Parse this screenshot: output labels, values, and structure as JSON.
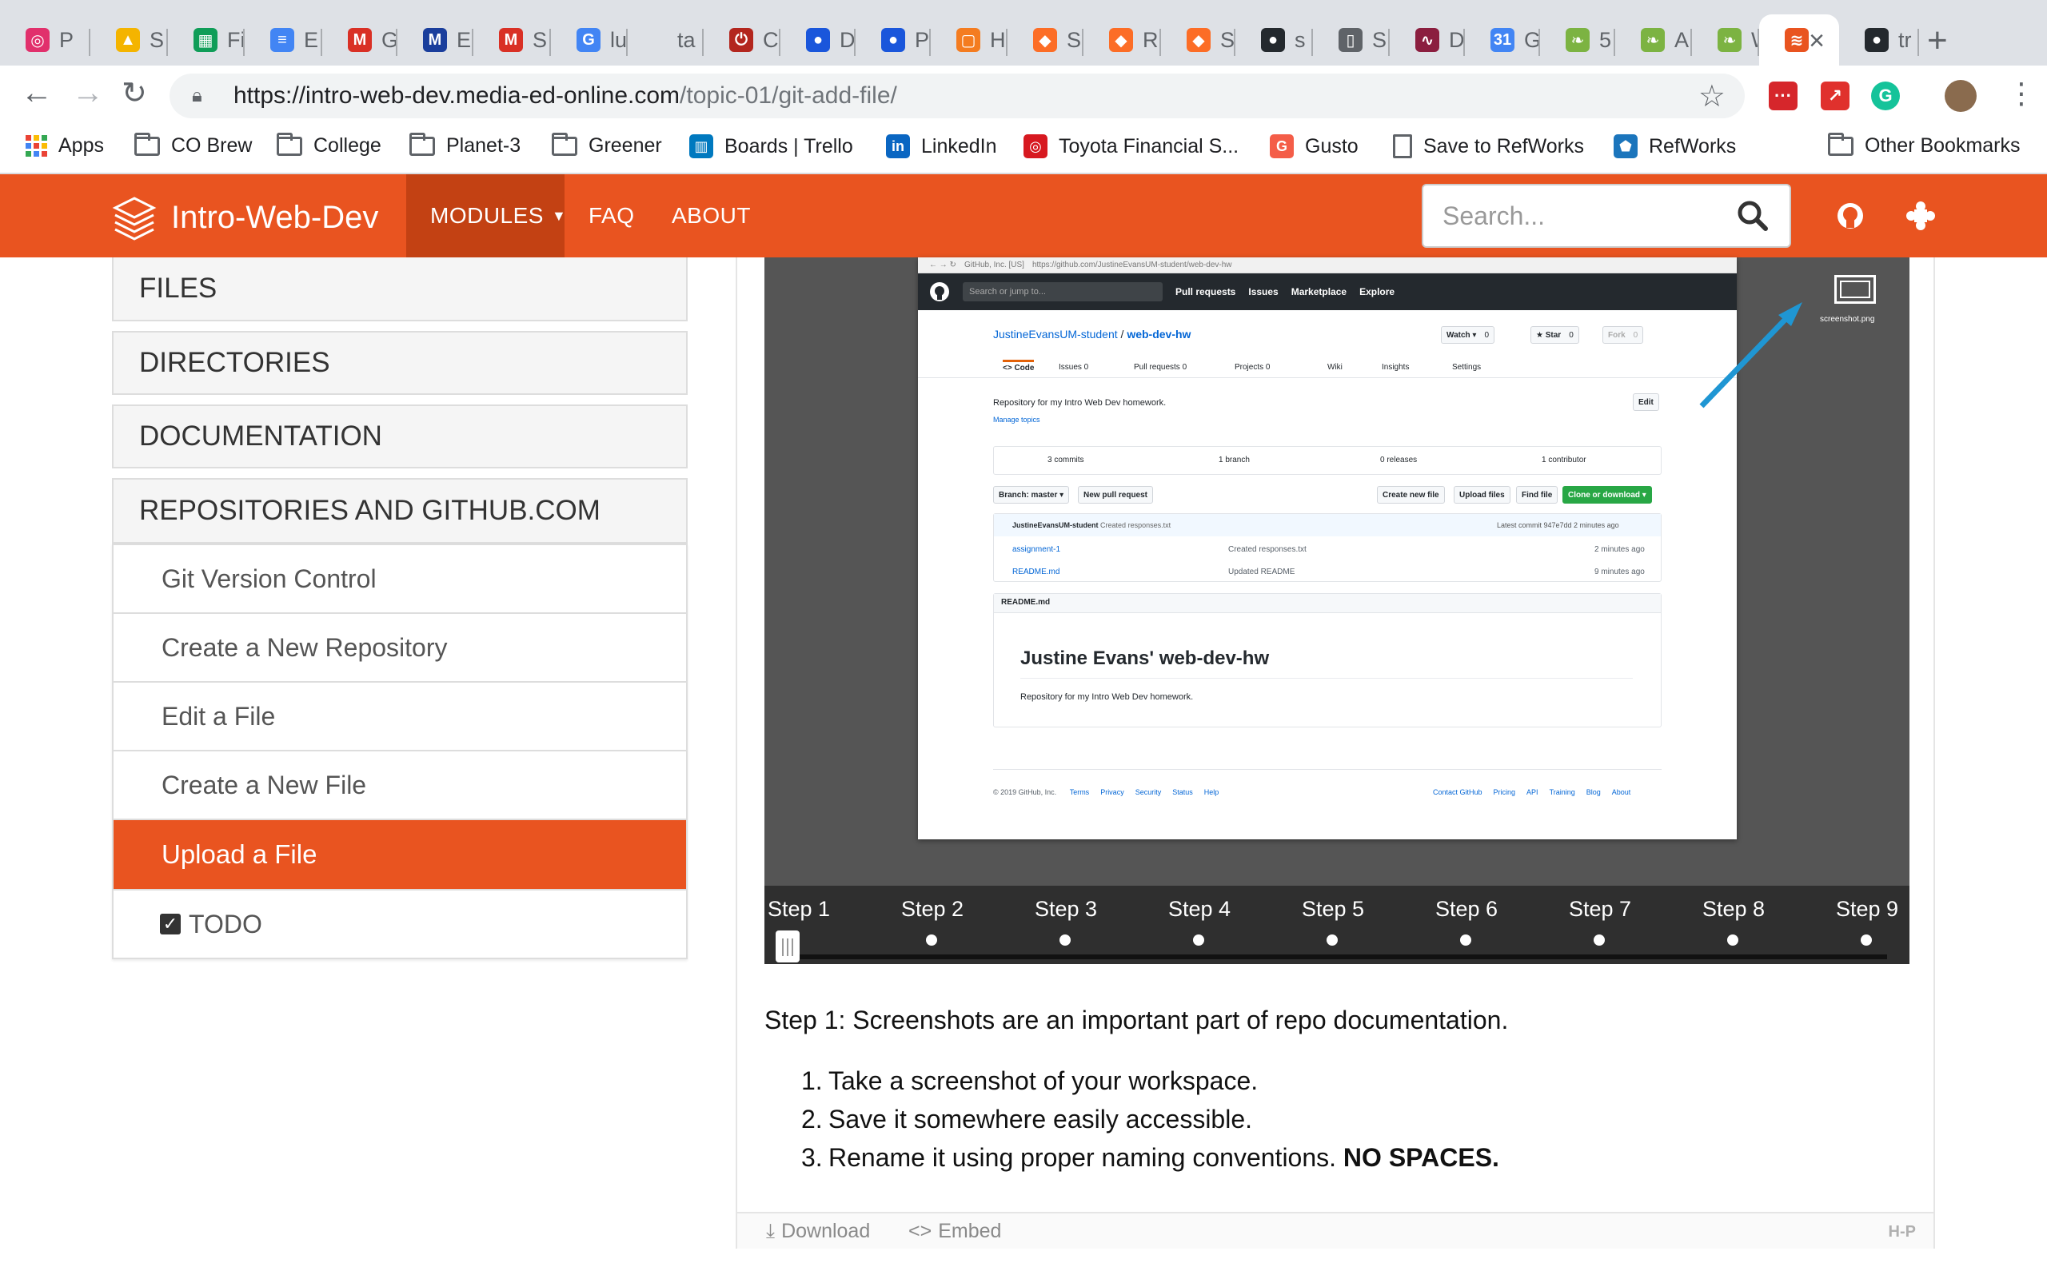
{
  "browser": {
    "tabs": [
      {
        "label": "P",
        "icon": "instagram-icon",
        "color": "#e1306c",
        "glyph": "◎"
      },
      {
        "label": "S",
        "icon": "google-drive-icon",
        "color": "#f4b400",
        "glyph": "▲"
      },
      {
        "label": "Fi",
        "icon": "google-sheets-icon",
        "color": "#0f9d58",
        "glyph": "▦"
      },
      {
        "label": "E",
        "icon": "google-docs-icon",
        "color": "#4285f4",
        "glyph": "≡"
      },
      {
        "label": "G",
        "icon": "gmail-icon",
        "color": "#d93025",
        "glyph": "M"
      },
      {
        "label": "E",
        "icon": "media-ed-icon",
        "color": "#1a3e9c",
        "glyph": "M"
      },
      {
        "label": "S",
        "icon": "gmail-icon",
        "color": "#d93025",
        "glyph": "M"
      },
      {
        "label": "lu",
        "icon": "google-icon",
        "color": "#4285f4",
        "glyph": "G"
      },
      {
        "label": "ta",
        "icon": "blank-icon",
        "color": "#dee1e6",
        "glyph": ""
      },
      {
        "label": "C",
        "icon": "power-icon",
        "color": "#b3261e",
        "glyph": "⏻"
      },
      {
        "label": "D",
        "icon": "circle-app-icon",
        "color": "#1a56db",
        "glyph": "●"
      },
      {
        "label": "P",
        "icon": "circle-app-icon",
        "color": "#1a56db",
        "glyph": "●"
      },
      {
        "label": "H",
        "icon": "square-app-icon",
        "color": "#f47c20",
        "glyph": "▢"
      },
      {
        "label": "S",
        "icon": "gitlab-icon",
        "color": "#fc6d26",
        "glyph": "◆"
      },
      {
        "label": "R",
        "icon": "gitlab-icon",
        "color": "#fc6d26",
        "glyph": "◆"
      },
      {
        "label": "S",
        "icon": "gitlab-icon",
        "color": "#fc6d26",
        "glyph": "◆"
      },
      {
        "label": "s",
        "icon": "github-icon",
        "color": "#24292e",
        "glyph": "●"
      },
      {
        "label": "S",
        "icon": "document-icon",
        "color": "#5f6368",
        "glyph": "▯"
      },
      {
        "label": "D",
        "icon": "chart-line-icon",
        "color": "#8b1e3f",
        "glyph": "∿"
      },
      {
        "label": "G",
        "icon": "google-calendar-icon",
        "color": "#4285f4",
        "glyph": "31"
      },
      {
        "label": "5",
        "icon": "leaf-icon",
        "color": "#7cb342",
        "glyph": "❧"
      },
      {
        "label": "A",
        "icon": "leaf-icon",
        "color": "#7cb342",
        "glyph": "❧"
      },
      {
        "label": "W",
        "icon": "leaf-icon",
        "color": "#7cb342",
        "glyph": "❧"
      },
      {
        "label": "",
        "icon": "stack-layers-icon",
        "color": "#e95420",
        "glyph": "≋",
        "active": true
      },
      {
        "label": "tr",
        "icon": "github-icon",
        "color": "#24292e",
        "glyph": "●"
      }
    ],
    "new_tab": "+",
    "url_host": "https://intro-web-dev.media-ed-online.com",
    "url_path": "/topic-01/git-add-file/",
    "bookmarks": [
      {
        "label": "Apps",
        "icon": "apps-grid-icon"
      },
      {
        "label": "CO Brew",
        "icon": "folder-icon"
      },
      {
        "label": "College",
        "icon": "folder-icon"
      },
      {
        "label": "Planet-3",
        "icon": "folder-icon"
      },
      {
        "label": "Greener",
        "icon": "folder-icon"
      },
      {
        "label": "Boards | Trello",
        "icon": "trello-icon"
      },
      {
        "label": "LinkedIn",
        "icon": "linkedin-icon"
      },
      {
        "label": "Toyota Financial S...",
        "icon": "toyota-icon"
      },
      {
        "label": "Gusto",
        "icon": "gusto-icon"
      },
      {
        "label": "Save to RefWorks",
        "icon": "document-icon"
      },
      {
        "label": "RefWorks",
        "icon": "refworks-icon"
      },
      {
        "label": "Other Bookmarks",
        "icon": "folder-icon"
      }
    ]
  },
  "site": {
    "brand": "Intro-Web-Dev",
    "nav": {
      "modules": "MODULES",
      "faq": "FAQ",
      "about": "ABOUT"
    },
    "search_placeholder": "Search...",
    "accent": "#e95420"
  },
  "sidebar": {
    "sections": [
      "FILES",
      "DIRECTORIES",
      "DOCUMENTATION"
    ],
    "open_section": "REPOSITORIES AND GITHUB.COM",
    "items": [
      {
        "label": "Git Version Control"
      },
      {
        "label": "Create a New Repository"
      },
      {
        "label": "Edit a File"
      },
      {
        "label": "Create a New File"
      },
      {
        "label": "Upload a File",
        "active": true
      },
      {
        "label": "TODO",
        "checkbox": true
      }
    ]
  },
  "slide": {
    "github": {
      "chrome_text": "GitHub, Inc. [US]",
      "chrome_url": "https://github.com/JustineEvansUM-student/web-dev-hw",
      "search": "Search or jump to...",
      "nav": [
        "Pull requests",
        "Issues",
        "Marketplace",
        "Explore"
      ],
      "owner": "JustineEvansUM-student",
      "sep": "/",
      "repo": "web-dev-hw",
      "watch": "Watch ▾",
      "watch_count": "0",
      "star": "★ Star",
      "star_count": "0",
      "fork": "Fork",
      "fork_count": "0",
      "tabs": [
        "<> Code",
        "Issues 0",
        "Pull requests 0",
        "Projects 0",
        "Wiki",
        "Insights",
        "Settings"
      ],
      "description": "Repository for my Intro Web Dev homework.",
      "edit": "Edit",
      "manage_topics": "Manage topics",
      "stats": [
        "3 commits",
        "1 branch",
        "0 releases",
        "1 contributor"
      ],
      "branch": "Branch: master ▾",
      "new_pr": "New pull request",
      "create_file": "Create new file",
      "upload_files": "Upload files",
      "find_file": "Find file",
      "clone": "Clone or download ▾",
      "commit_user": "JustineEvansUM-student",
      "commit_msg": "Created responses.txt",
      "latest_commit": "Latest commit 947e7dd 2 minutes ago",
      "files": [
        {
          "name": "assignment-1",
          "msg": "Created responses.txt",
          "time": "2 minutes ago"
        },
        {
          "name": "README.md",
          "msg": "Updated README",
          "time": "9 minutes ago"
        }
      ],
      "readme_label": "README.md",
      "readme_title": "Justine Evans' web-dev-hw",
      "readme_body": "Repository for my Intro Web Dev homework.",
      "footer_left": "© 2019 GitHub, Inc.",
      "footer_links_left": [
        "Terms",
        "Privacy",
        "Security",
        "Status",
        "Help"
      ],
      "footer_links_right": [
        "Contact GitHub",
        "Pricing",
        "API",
        "Training",
        "Blog",
        "About"
      ]
    },
    "file_label": "screenshot.png",
    "steps": [
      "Step 1",
      "Step 2",
      "Step 3",
      "Step 4",
      "Step 5",
      "Step 6",
      "Step 7",
      "Step 8",
      "Step 9"
    ],
    "current_step": 1,
    "caption": "Step 1: Screenshots are an important part of repo documentation.",
    "instructions": [
      {
        "num": "1.",
        "text": "Take a screenshot of your workspace.",
        "bold": ""
      },
      {
        "num": "2.",
        "text": "Save it somewhere easily accessible.",
        "bold": ""
      },
      {
        "num": "3.",
        "text": "Rename it using proper naming conventions.",
        "bold": "NO SPACES."
      }
    ],
    "footer": {
      "download": "Download",
      "embed": "Embed",
      "logo": "H-P"
    }
  }
}
